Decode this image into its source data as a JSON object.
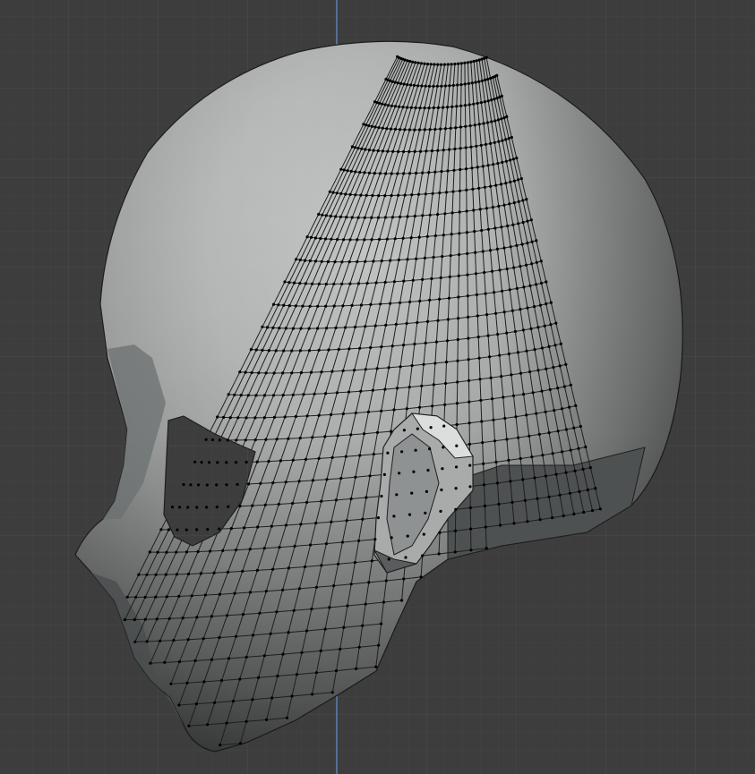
{
  "viewport": {
    "background_color": "#3d3d3d",
    "grid_minor_color": "#444444",
    "grid_major_color": "#4a4a4a",
    "axis_color": "#5f7fb6"
  },
  "mesh": {
    "wire_color": "#1e1e1e",
    "vertex_color": "#000000",
    "shade_light": "#cdcfcf",
    "shade_mid": "#a6a8a8",
    "shade_dark": "#5b5e5e",
    "hole_color": "#3d3d3d"
  }
}
